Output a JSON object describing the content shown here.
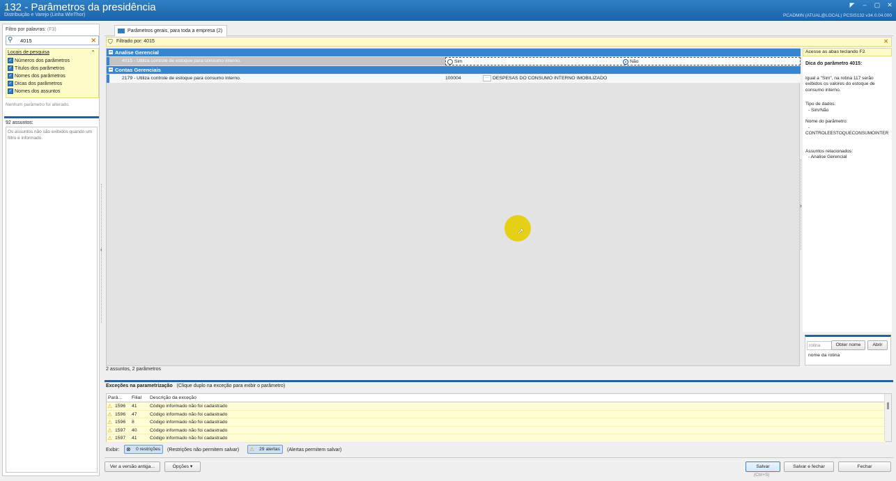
{
  "window": {
    "title": "132 - Parâmetros da presidência",
    "subtitle": "Distribuição e Varejo (Linha WinThor)",
    "userinfo": "PCADMIN (ATUAL@LOCAL)  PCSIS132 v34.0.04.000",
    "controls": [
      "◤",
      "–",
      "▢",
      "✕"
    ]
  },
  "filter": {
    "label": "Filtro por palavras:",
    "shortcut": "(F3)",
    "value": "4015",
    "clear_icon": "✕",
    "search_icon": "search-icon"
  },
  "locais": {
    "title": "Locais de pesquisa",
    "collapse_icon": "⌃",
    "options": [
      {
        "label": "Números dos parâmetros",
        "checked": true
      },
      {
        "label": "Títulos dos parâmetros",
        "checked": true
      },
      {
        "label": "Nomes dos parâmetros",
        "checked": true
      },
      {
        "label": "Dicas dos parâmetros",
        "checked": true
      },
      {
        "label": "Nomes dos assuntos",
        "checked": true
      }
    ]
  },
  "no_change": "Nenhum parâmetro foi alterado.",
  "assuntos": {
    "count_label": "92 assuntos:",
    "message": "Os assuntos não são exibidos quando um filtro é informado."
  },
  "tab": {
    "label": "Parâmetros gerais, para toda a empresa  (2)"
  },
  "filtered": {
    "label": "Filtrado por: 4015",
    "close_icon": "✕"
  },
  "grid": {
    "groups": [
      {
        "name": "Analise Gerencial",
        "rows": [
          {
            "desc": "4015 - Utiliza controle de estoque para consumo interno.",
            "selected": true,
            "radio_sim": "Sim",
            "radio_nao": "Não",
            "value": "Não"
          }
        ]
      },
      {
        "name": "Contas Gerenciais",
        "rows": [
          {
            "desc": "2179 - Utiliza controle de estoque para consumo interno.",
            "selected": false,
            "code": "100004",
            "code_desc": "DESPESAS DO CONSUMO INTERNO IMOBILIZADO"
          }
        ]
      }
    ],
    "status": "2 assuntos, 2 parâmetros"
  },
  "tip": {
    "banner": "Acesse as abas teclando F2",
    "title": "Dica do parâmetro 4015:",
    "body": "Igual a \"Sim\", na rotina 117 serão exibidos os valores do estoque de consumo interno.",
    "type_label": "Tipo de dados:",
    "type_value": "- Sim/Não",
    "name_label": "Nome do parâmetro:",
    "name_dash": "-",
    "name_value": "CONTROLEESTOQUECONSUMOINTER",
    "related_label": "Assuntos relacionados:",
    "related_value": "- Analise Gerencial"
  },
  "rotina": {
    "placeholder": "rotina",
    "obter_label": "Obter nome",
    "abrir_label": "Abrir",
    "name_label": "nome da rotina"
  },
  "exceptions": {
    "title": "Exceções na parametrização",
    "hint": "(Clique duplo na exceção para exibir o parâmetro)",
    "columns": [
      "Parâ...",
      "Filial",
      "Descrição da exceção"
    ],
    "rows": [
      {
        "param": "1596",
        "filial": "41",
        "desc": "Código informado não foi cadastrado"
      },
      {
        "param": "1596",
        "filial": "47",
        "desc": "Código informado não foi cadastrado"
      },
      {
        "param": "1596",
        "filial": "8",
        "desc": "Código informado não foi cadastrado"
      },
      {
        "param": "1597",
        "filial": "40",
        "desc": "Código informado não foi cadastrado"
      },
      {
        "param": "1597",
        "filial": "41",
        "desc": "Código informado não foi cadastrado"
      }
    ]
  },
  "exibir": {
    "label": "Exibir:",
    "restricoes": "0 restrições",
    "restricoes_note": "(Restrições não permitem salvar)",
    "alertas": "29 alertas",
    "alertas_note": "(Alertas permitem salvar)"
  },
  "footer": {
    "ver_versao": "Ver a versão antiga...",
    "opcoes": "Opções ▾",
    "salvar": "Salvar",
    "salvar_shortcut": "(Ctrl+S)",
    "salvar_fechar": "Salvar e fechar",
    "fechar": "Fechar"
  }
}
